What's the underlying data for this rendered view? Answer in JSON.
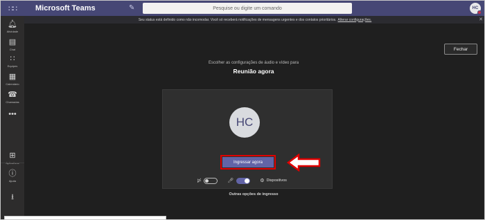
{
  "topbar": {
    "waffle_icon": "app-launcher-icon",
    "app_title": "Microsoft Teams",
    "compose_icon": "compose-icon",
    "search_placeholder": "Pesquise ou digite um comando",
    "avatar_initials": "HC",
    "presence_color": "#c4314b"
  },
  "rail": {
    "items": [
      {
        "label": "Atividade",
        "icon": "bell-icon"
      },
      {
        "label": "Chat",
        "icon": "chat-icon"
      },
      {
        "label": "Equipes",
        "icon": "teams-icon"
      },
      {
        "label": "Calendário",
        "icon": "calendar-icon"
      },
      {
        "label": "Chamadas",
        "icon": "phone-icon"
      },
      {
        "label": "",
        "icon": "more-icon"
      },
      {
        "label": "Aplicativos",
        "icon": "apps-icon"
      },
      {
        "label": "Ajuda",
        "icon": "help-icon"
      }
    ]
  },
  "banner": {
    "text": "Seu status está definido como não incomodar. Você só receberá notificações de mensagens urgentes e dos contatos prioritários.",
    "link": "Alterar configurações."
  },
  "main": {
    "close_label": "Fechar",
    "choose_text": "Escolher as configurações de áudio e vídeo para",
    "meeting_title": "Reunião agora",
    "avatar_initials": "HC",
    "join_label": "Ingressar agora",
    "devices_label": "Dispositivos",
    "other_options": "Outras opções de ingresso"
  },
  "colors": {
    "brand": "#464775",
    "accent": "#6264a7",
    "highlight": "#e00000"
  }
}
